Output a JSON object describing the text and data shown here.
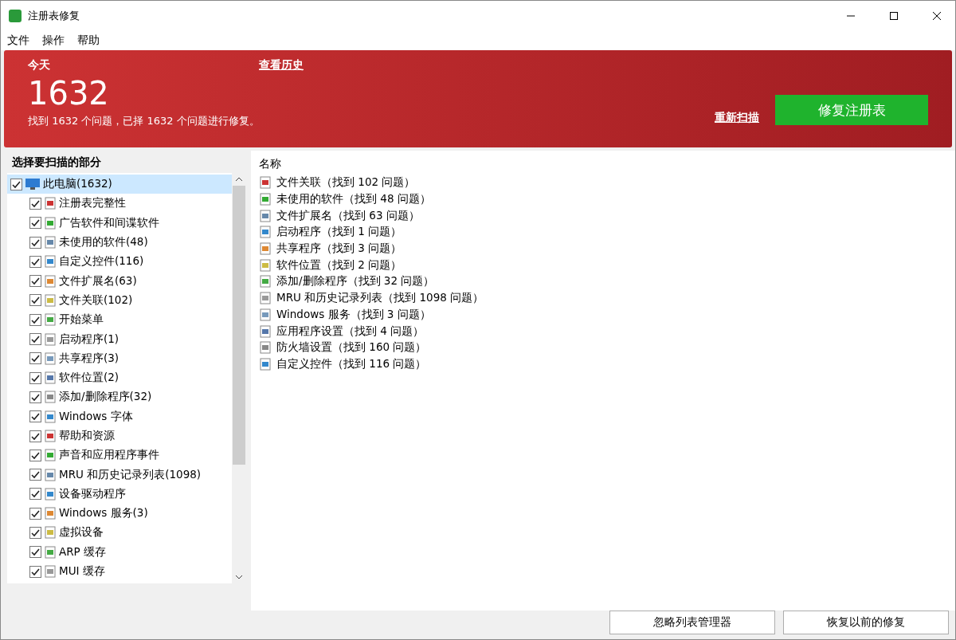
{
  "window": {
    "title": "注册表修复"
  },
  "menu": [
    "文件",
    "操作",
    "帮助"
  ],
  "banner": {
    "headline": "今天",
    "history_link": "查看历史",
    "count": "1632",
    "summary": "找到 1632 个问题，已择 1632 个问题进行修复。",
    "rescan_link": "重新扫描",
    "fix_button": "修复注册表"
  },
  "sections": {
    "title": "选择要扫描的部分",
    "tree": [
      {
        "label": "此电脑(1632)",
        "checked": true,
        "selected": true,
        "children": [
          {
            "label": "注册表完整性",
            "checked": true,
            "selected": false
          },
          {
            "label": "广告软件和间谍软件",
            "checked": true,
            "selected": false
          },
          {
            "label": "未使用的软件(48)",
            "checked": true,
            "selected": false
          },
          {
            "label": "自定义控件(116)",
            "checked": true,
            "selected": false
          },
          {
            "label": "文件扩展名(63)",
            "checked": true,
            "selected": false
          },
          {
            "label": "文件关联(102)",
            "checked": true,
            "selected": false
          },
          {
            "label": "开始菜单",
            "checked": true,
            "selected": false
          },
          {
            "label": "启动程序(1)",
            "checked": true,
            "selected": false
          },
          {
            "label": "共享程序(3)",
            "checked": true,
            "selected": false
          },
          {
            "label": "软件位置(2)",
            "checked": true,
            "selected": false
          },
          {
            "label": "添加/删除程序(32)",
            "checked": true,
            "selected": false
          },
          {
            "label": "Windows 字体",
            "checked": true,
            "selected": false
          },
          {
            "label": "帮助和资源",
            "checked": true,
            "selected": false
          },
          {
            "label": "声音和应用程序事件",
            "checked": true,
            "selected": false
          },
          {
            "label": "MRU 和历史记录列表(1098)",
            "checked": true,
            "selected": false
          },
          {
            "label": "设备驱动程序",
            "checked": true,
            "selected": false
          },
          {
            "label": "Windows 服务(3)",
            "checked": true,
            "selected": false
          },
          {
            "label": "虚拟设备",
            "checked": true,
            "selected": false
          },
          {
            "label": "ARP 缓存",
            "checked": true,
            "selected": false
          },
          {
            "label": "MUI 缓存",
            "checked": true,
            "selected": false
          }
        ]
      }
    ]
  },
  "results": {
    "column": "名称",
    "items": [
      "文件关联（找到 102 问题）",
      "未使用的软件（找到 48 问题）",
      "文件扩展名（找到 63 问题）",
      "启动程序（找到 1 问题）",
      "共享程序（找到 3 问题）",
      "软件位置（找到 2 问题）",
      "添加/删除程序（找到 32 问题）",
      "MRU 和历史记录列表（找到 1098 问题）",
      "Windows 服务（找到 3 问题）",
      "应用程序设置（找到 4 问题）",
      "防火墙设置（找到 160 问题）",
      "自定义控件（找到 116 问题）"
    ]
  },
  "buttons": [
    "忽略列表管理器",
    "恢复以前的修复"
  ]
}
